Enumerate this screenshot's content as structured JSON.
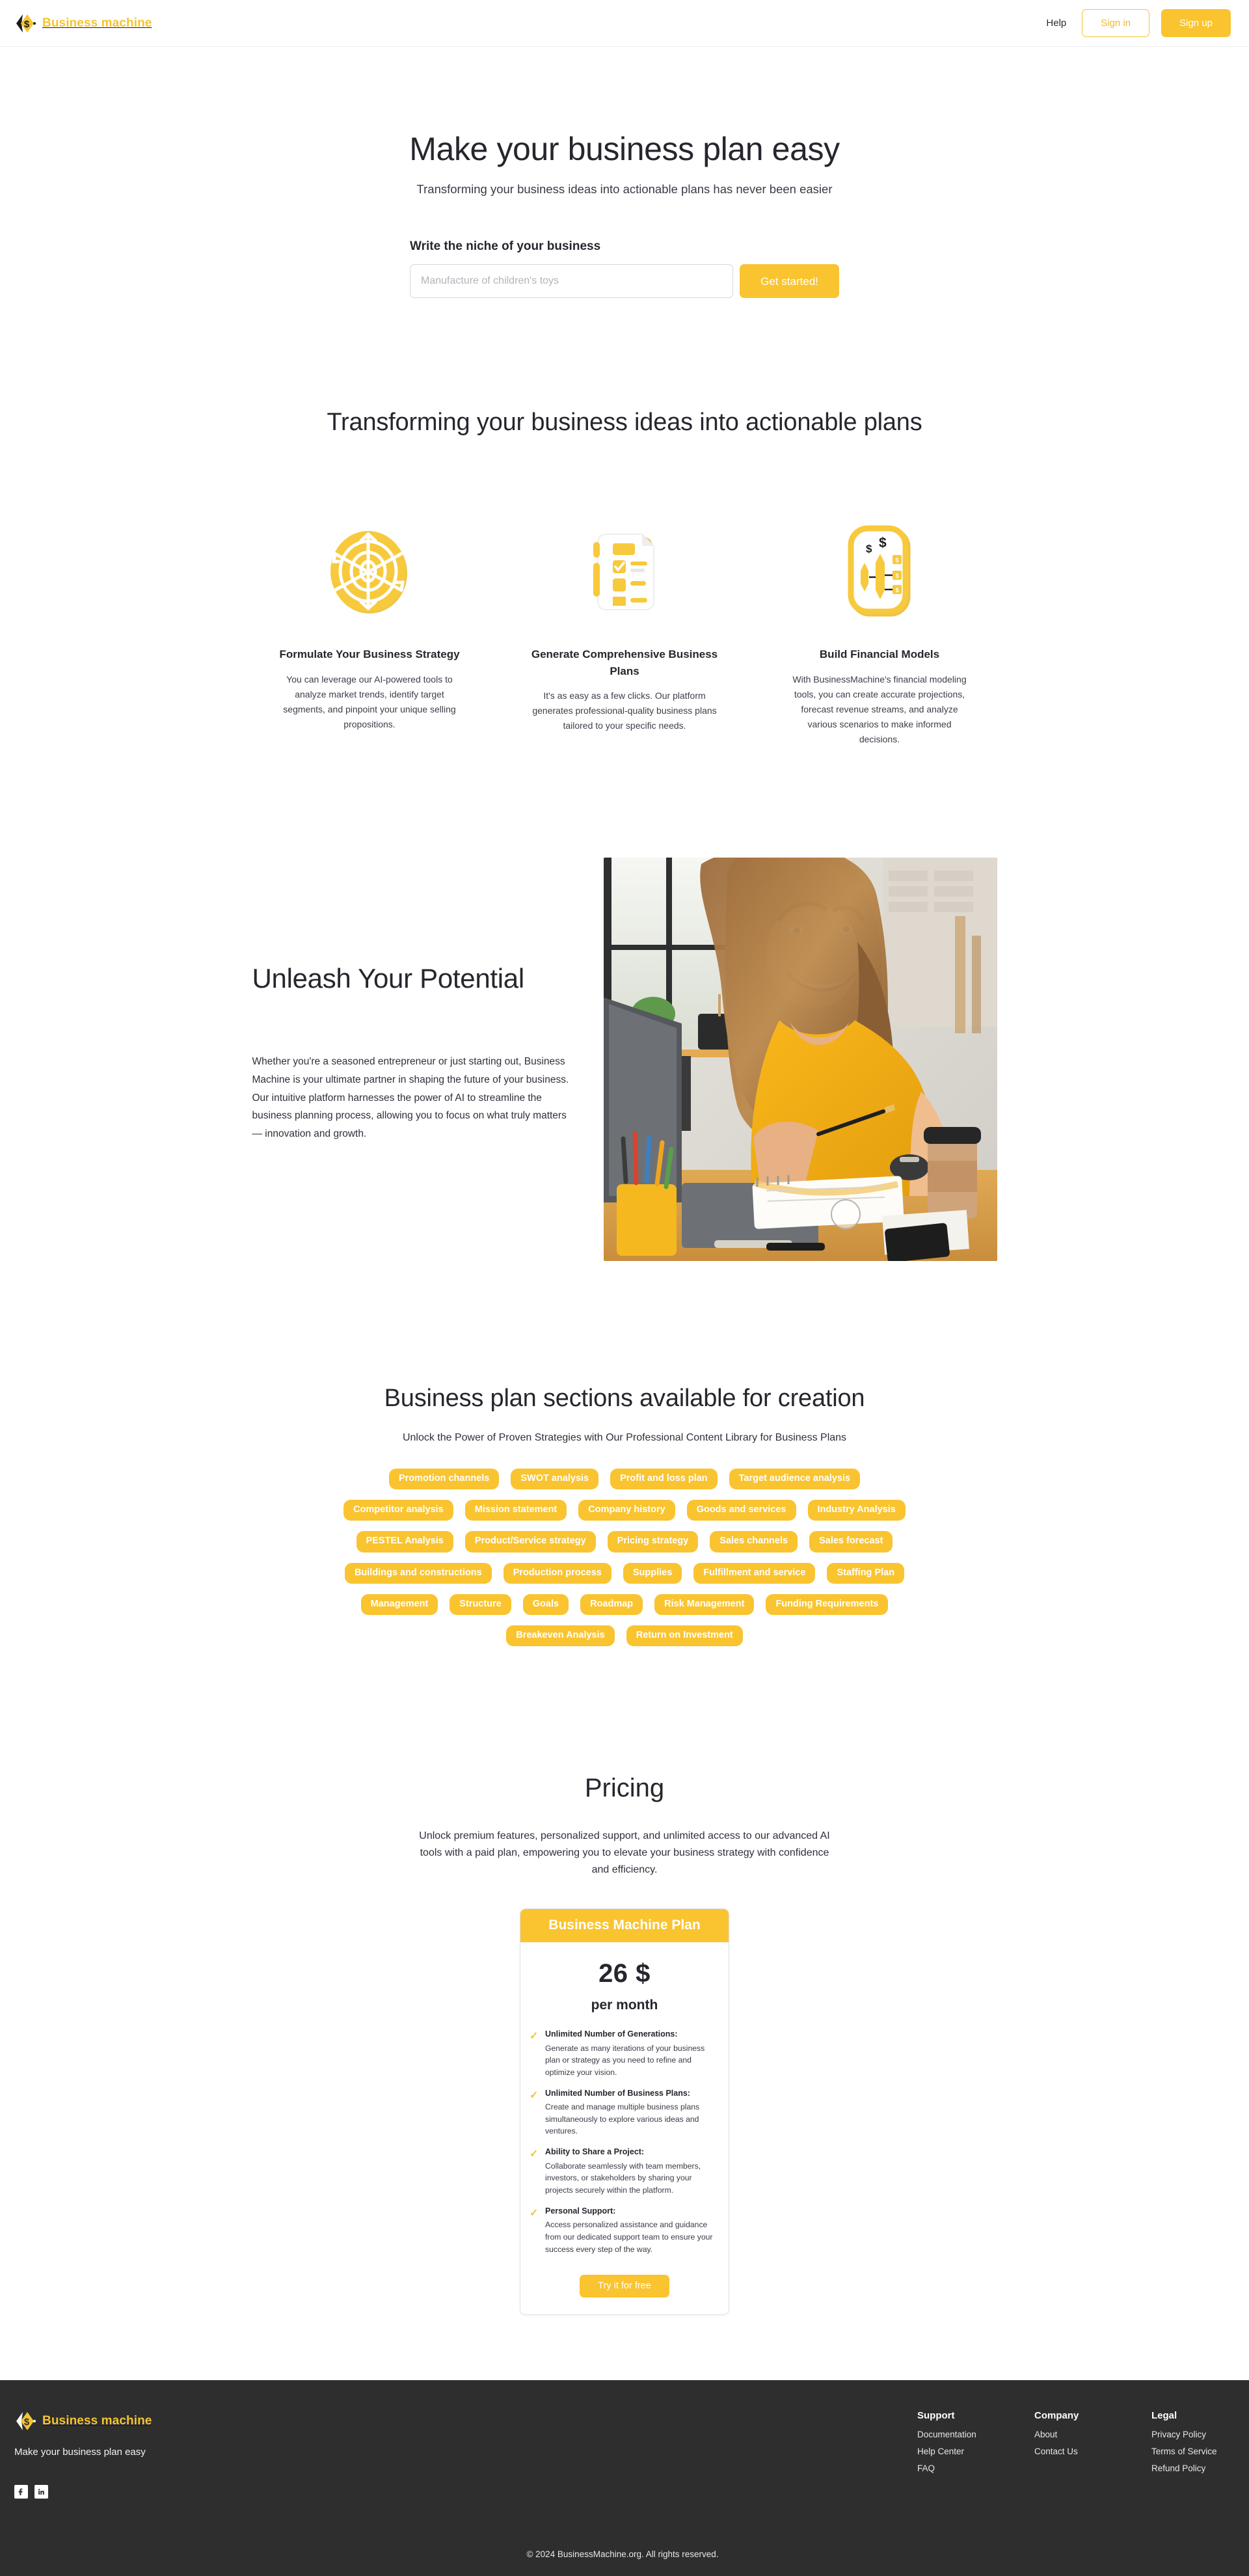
{
  "brand": {
    "name": "Business machine",
    "logo_icon": "diamond-dollar-logo-icon",
    "accent_color": "#f9c430",
    "dark_color": "#2e2e2e"
  },
  "header": {
    "help_label": "Help",
    "sign_in_label": "Sign in",
    "sign_up_label": "Sign up"
  },
  "hero": {
    "title": "Make your business plan easy",
    "subtitle": "Transforming your business ideas into actionable plans has never been easier",
    "form_label": "Write the niche of your business",
    "input_value": "",
    "input_placeholder": "Manufacture of children's toys",
    "cta_label": "Get started!"
  },
  "features": {
    "title": "Transforming your business ideas into actionable plans",
    "cards": [
      {
        "icon": "target-strategy-icon",
        "title": "Formulate Your Business Strategy",
        "desc": "You can leverage our AI-powered tools to analyze market trends, identify target segments, and pinpoint your unique selling propositions."
      },
      {
        "icon": "checklist-document-icon",
        "title": "Generate Comprehensive Business Plans",
        "desc": "It's as easy as a few clicks. Our platform generates professional-quality business plans tailored to your specific needs."
      },
      {
        "icon": "financial-model-icon",
        "title": "Build Financial Models",
        "desc": "With BusinessMachine's financial modeling tools, you can create accurate projections, forecast revenue streams, and analyze various scenarios to make informed decisions."
      }
    ]
  },
  "unleash": {
    "title": "Unleash Your Potential",
    "body": "Whether you're a seasoned entrepreneur or just starting out, Business Machine is your ultimate partner in shaping the future of your business. Our intuitive platform harnesses the power of AI to streamline the business planning process, allowing you to focus on what truly matters — innovation and growth.",
    "photo_alt": "smiling-woman-working-at-desk-photo"
  },
  "sections": {
    "title": "Business plan sections available for creation",
    "subtitle": "Unlock the Power of Proven Strategies with Our Professional Content Library for Business Plans",
    "rows": [
      [
        "Promotion channels",
        "SWOT analysis",
        "Profit and loss plan",
        "Target audience analysis"
      ],
      [
        "Competitor analysis",
        "Mission statement",
        "Company history",
        "Goods and services",
        "Industry Analysis"
      ],
      [
        "PESTEL Analysis",
        "Product/Service strategy",
        "Pricing strategy",
        "Sales channels",
        "Sales forecast"
      ],
      [
        "Buildings and constructions",
        "Production process",
        "Supplies",
        "Fulfillment and service",
        "Staffing Plan"
      ],
      [
        "Management",
        "Structure",
        "Goals",
        "Roadmap",
        "Risk Management",
        "Funding Requirements"
      ],
      [
        "Breakeven Analysis",
        "Return on Investment"
      ]
    ]
  },
  "pricing": {
    "title": "Pricing",
    "subtitle": "Unlock premium features, personalized support, and unlimited access to our advanced AI tools with a paid plan, empowering you to elevate your business strategy with confidence and efficiency.",
    "plan_name": "Business Machine Plan",
    "price": "26 $",
    "period": "per month",
    "features": [
      {
        "title": "Unlimited Number of Generations:",
        "desc": "Generate as many iterations of your business plan or strategy as you need to refine and optimize your vision."
      },
      {
        "title": "Unlimited Number of Business Plans:",
        "desc": "Create and manage multiple business plans simultaneously to explore various ideas and ventures."
      },
      {
        "title": "Ability to Share a Project:",
        "desc": "Collaborate seamlessly with team members, investors, or stakeholders by sharing your projects securely within the platform."
      },
      {
        "title": "Personal Support:",
        "desc": "Access personalized assistance and guidance from our dedicated support team to ensure your success every step of the way."
      }
    ],
    "cta_label": "Try it for free"
  },
  "footer": {
    "tagline": "Make your business plan easy",
    "social": [
      "facebook-icon",
      "linkedin-icon"
    ],
    "columns": [
      {
        "heading": "Support",
        "links": [
          "Documentation",
          "Help Center",
          "FAQ"
        ]
      },
      {
        "heading": "Company",
        "links": [
          "About",
          "Contact Us"
        ]
      },
      {
        "heading": "Legal",
        "links": [
          "Privacy Policy",
          "Terms of Service",
          "Refund Policy"
        ]
      }
    ],
    "copyright": "© 2024 BusinessMachine.org. All rights reserved."
  }
}
